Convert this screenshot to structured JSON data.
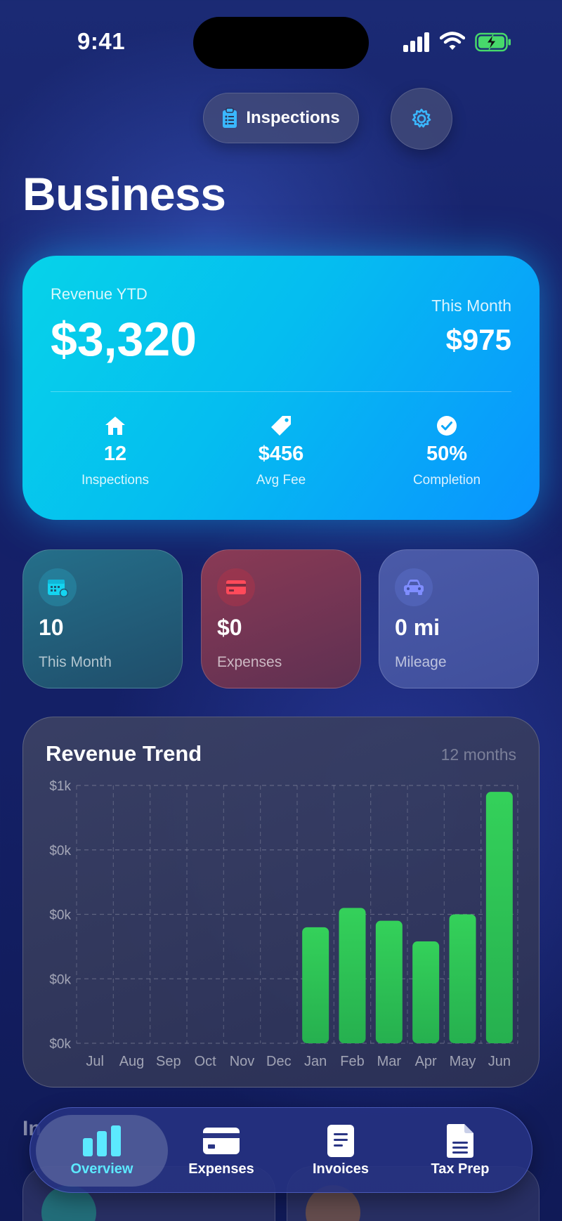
{
  "status_bar": {
    "time": "9:41"
  },
  "header": {
    "inspections_button_label": "Inspections",
    "title": "Business"
  },
  "revenue_card": {
    "ytd_label": "Revenue YTD",
    "ytd_value": "$3,320",
    "month_label": "This Month",
    "month_value": "$975",
    "stats": [
      {
        "icon": "house-icon",
        "value": "12",
        "label": "Inspections"
      },
      {
        "icon": "tag-icon",
        "value": "$456",
        "label": "Avg Fee"
      },
      {
        "icon": "check-circle-icon",
        "value": "50%",
        "label": "Completion"
      }
    ]
  },
  "mini_cards": [
    {
      "icon": "calendar-icon",
      "value": "10",
      "label": "This Month"
    },
    {
      "icon": "credit-card-icon",
      "value": "$0",
      "label": "Expenses"
    },
    {
      "icon": "car-icon",
      "value": "0 mi",
      "label": "Mileage"
    }
  ],
  "chart": {
    "title": "Revenue Trend",
    "subtitle": "12 months"
  },
  "chart_data": {
    "type": "bar",
    "title": "Revenue Trend",
    "subtitle": "12 months",
    "categories": [
      "Jul",
      "Aug",
      "Sep",
      "Oct",
      "Nov",
      "Dec",
      "Jan",
      "Feb",
      "Mar",
      "Apr",
      "May",
      "Jun"
    ],
    "values": [
      0,
      0,
      0,
      0,
      0,
      0,
      450,
      525,
      475,
      395,
      500,
      975
    ],
    "y_tick_labels": [
      "$0k",
      "$0k",
      "$0k",
      "$0k",
      "$1k"
    ],
    "ylim": [
      0,
      1000
    ],
    "grid": true,
    "bar_color": "#2fcb5a"
  },
  "peek": {
    "section_title": "In"
  },
  "tab_bar": {
    "tabs": [
      {
        "label": "Overview",
        "icon": "bar-chart-icon",
        "active": true
      },
      {
        "label": "Expenses",
        "icon": "credit-card-icon",
        "active": false
      },
      {
        "label": "Invoices",
        "icon": "invoice-icon",
        "active": false
      },
      {
        "label": "Tax Prep",
        "icon": "document-icon",
        "active": false
      }
    ]
  },
  "colors": {
    "accent": "#5ce9ff",
    "green": "#2fcb5a"
  }
}
